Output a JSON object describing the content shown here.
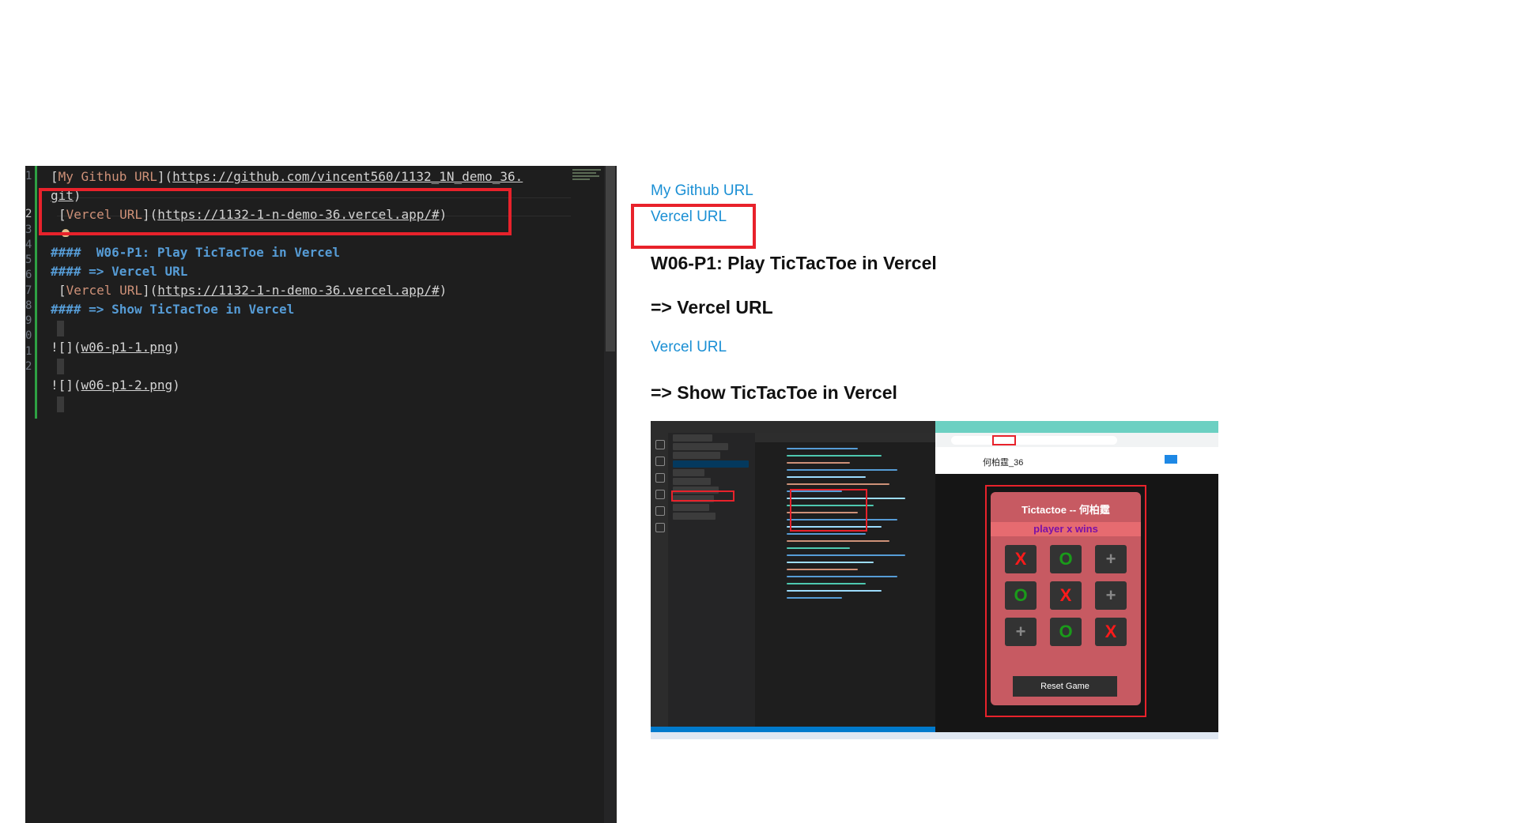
{
  "editor": {
    "line_numbers": [
      "1",
      "2",
      "3",
      "4",
      "5",
      "6",
      "7",
      "8",
      "9",
      "0",
      "1",
      "2"
    ],
    "lines": {
      "l1": {
        "b1": "[",
        "text": "My Github URL",
        "b2": "](",
        "url": "https://github.com/vincent560/1132_1N_demo_36.",
        "b3": ""
      },
      "l1b": {
        "url": "git",
        "b3": ")"
      },
      "l2": {
        "b1": "[",
        "text": "Vercel URL",
        "b2": "](",
        "url": "https://1132-1-n-demo-36.vercel.app/#",
        "b3": ")"
      },
      "l4": "####  W06-P1: Play TicTacToe in Vercel",
      "l5": "#### => Vercel URL",
      "l6": {
        "b1": "[",
        "text": "Vercel URL",
        "b2": "](",
        "url": "https://1132-1-n-demo-36.vercel.app/#",
        "b3": ")"
      },
      "l7": "#### => Show TicTacToe in Vercel",
      "l9": {
        "pre": "![](",
        "file": "w06-p1-1.png",
        "post": ")"
      },
      "l11": {
        "pre": "![](",
        "file": "w06-p1-2.png",
        "post": ")"
      }
    }
  },
  "preview": {
    "github_link": "My Github URL",
    "vercel_link_1": "Vercel URL",
    "heading_w06": "W06-P1: Play TicTacToe in Vercel",
    "heading_vercel": "=> Vercel URL",
    "vercel_link_2": "Vercel URL",
    "heading_show": "=> Show TicTacToe in Vercel"
  },
  "screenshot": {
    "page_author": "何柏霆_36",
    "game_title": "Tictactoe -- 何柏霆",
    "game_status": "player x wins",
    "board": [
      "X",
      "O",
      "+",
      "O",
      "X",
      "+",
      "+",
      "O",
      "X"
    ],
    "reset_button": "Reset Game"
  },
  "colors": {
    "highlight_box": "#e8222b",
    "link": "#1a8fd4",
    "editor_bg": "#1e1e1e",
    "card": "#c75a62"
  }
}
